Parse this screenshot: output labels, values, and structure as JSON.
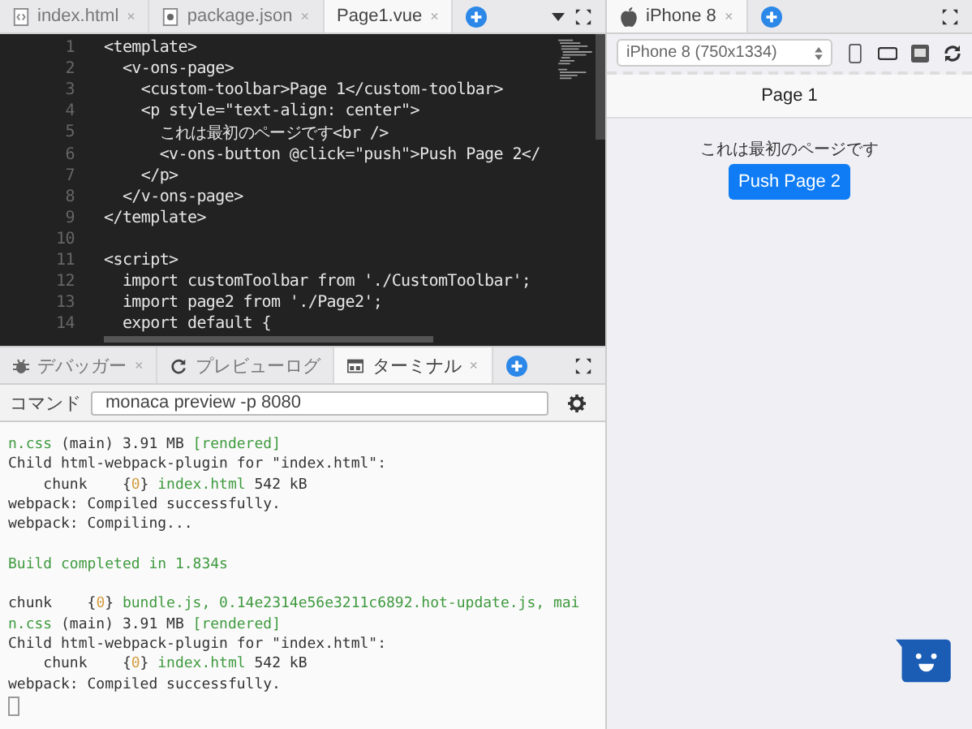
{
  "editor": {
    "tabs": [
      {
        "label": "index.html",
        "close": "×",
        "kind": "code-file",
        "selected": false
      },
      {
        "label": "package.json",
        "close": "×",
        "kind": "gear-file",
        "selected": false
      },
      {
        "label": "Page1.vue",
        "close": "×",
        "kind": "plain",
        "selected": true
      }
    ],
    "lines": [
      {
        "number": "1",
        "text": "<template>"
      },
      {
        "number": "2",
        "text": "  <v-ons-page>"
      },
      {
        "number": "3",
        "text": "    <custom-toolbar>Page 1</custom-toolbar>"
      },
      {
        "number": "4",
        "text": "    <p style=\"text-align: center\">"
      },
      {
        "number": "5",
        "text": "      これは最初のページです<br />"
      },
      {
        "number": "6",
        "text": "      <v-ons-button @click=\"push\">Push Page 2</"
      },
      {
        "number": "7",
        "text": "    </p>"
      },
      {
        "number": "8",
        "text": "  </v-ons-page>"
      },
      {
        "number": "9",
        "text": "</template>"
      },
      {
        "number": "10"
      },
      {
        "number": "11",
        "text": "<script>"
      },
      {
        "number": "12",
        "text": "  import customToolbar from './CustomToolbar';"
      },
      {
        "number": "13",
        "text": "  import page2 from './Page2';"
      },
      {
        "number": "14",
        "text": "  export default {"
      }
    ]
  },
  "bottom_panel": {
    "tabs": [
      {
        "label": "デバッガー",
        "close": "×",
        "kind": "bug",
        "selected": false
      },
      {
        "label": "プレビューログ",
        "kind": "refresh",
        "selected": false
      },
      {
        "label": "ターミナル",
        "close": "×",
        "kind": "terminal",
        "selected": true
      }
    ],
    "command": {
      "label": "コマンド",
      "value": "monaca preview -p 8080"
    },
    "terminal_lines": [
      {
        "kind": "text",
        "segments": [
          {
            "text": "n.css",
            "color": "#3f9a3f"
          },
          {
            "text": " (main) 3.91 MB ",
            "color": "#333333"
          },
          {
            "text": "[rendered]",
            "color": "#3f9a3f"
          }
        ]
      },
      {
        "kind": "text",
        "segments": [
          {
            "text": "Child html-webpack-plugin for \"index.html\":",
            "color": "#333333"
          }
        ]
      },
      {
        "kind": "text",
        "segments": [
          {
            "text": "    chunk    {",
            "color": "#333333"
          },
          {
            "text": "0",
            "color": "#d39b3c"
          },
          {
            "text": "} ",
            "color": "#333333"
          },
          {
            "text": "index.html",
            "color": "#3f9a3f"
          },
          {
            "text": " 542 kB",
            "color": "#333333"
          }
        ]
      },
      {
        "kind": "text",
        "segments": [
          {
            "text": "webpack: Compiled successfully.",
            "color": "#333333"
          }
        ]
      },
      {
        "kind": "text",
        "segments": [
          {
            "text": "webpack: Compiling...",
            "color": "#333333"
          }
        ]
      },
      {
        "kind": "blank"
      },
      {
        "kind": "text",
        "segments": [
          {
            "text": "Build completed in 1.834s",
            "color": "#3f9a3f"
          }
        ]
      },
      {
        "kind": "blank"
      },
      {
        "kind": "text",
        "segments": [
          {
            "text": "chunk    {",
            "color": "#333333"
          },
          {
            "text": "0",
            "color": "#d39b3c"
          },
          {
            "text": "} ",
            "color": "#333333"
          },
          {
            "text": "bundle.js, 0.14e2314e56e3211c6892.hot-update.js, mai",
            "color": "#3f9a3f"
          }
        ]
      },
      {
        "kind": "text",
        "segments": [
          {
            "text": "n.css",
            "color": "#3f9a3f"
          },
          {
            "text": " (main) 3.91 MB ",
            "color": "#333333"
          },
          {
            "text": "[rendered]",
            "color": "#3f9a3f"
          }
        ]
      },
      {
        "kind": "text",
        "segments": [
          {
            "text": "Child html-webpack-plugin for \"index.html\":",
            "color": "#333333"
          }
        ]
      },
      {
        "kind": "text",
        "segments": [
          {
            "text": "    chunk    {",
            "color": "#333333"
          },
          {
            "text": "0",
            "color": "#d39b3c"
          },
          {
            "text": "} ",
            "color": "#333333"
          },
          {
            "text": "index.html",
            "color": "#3f9a3f"
          },
          {
            "text": " 542 kB",
            "color": "#333333"
          }
        ]
      },
      {
        "kind": "text",
        "segments": [
          {
            "text": "webpack: Compiled successfully.",
            "color": "#333333"
          }
        ]
      },
      {
        "kind": "cursor"
      }
    ]
  },
  "preview": {
    "tabs": [
      {
        "label": "iPhone 8",
        "close": "×",
        "selected": true
      }
    ],
    "device_select": {
      "value": "iPhone 8 (750x1334)"
    },
    "toolbar_title": "Page 1",
    "text": "これは最初のページです",
    "button": "Push Page 2"
  }
}
